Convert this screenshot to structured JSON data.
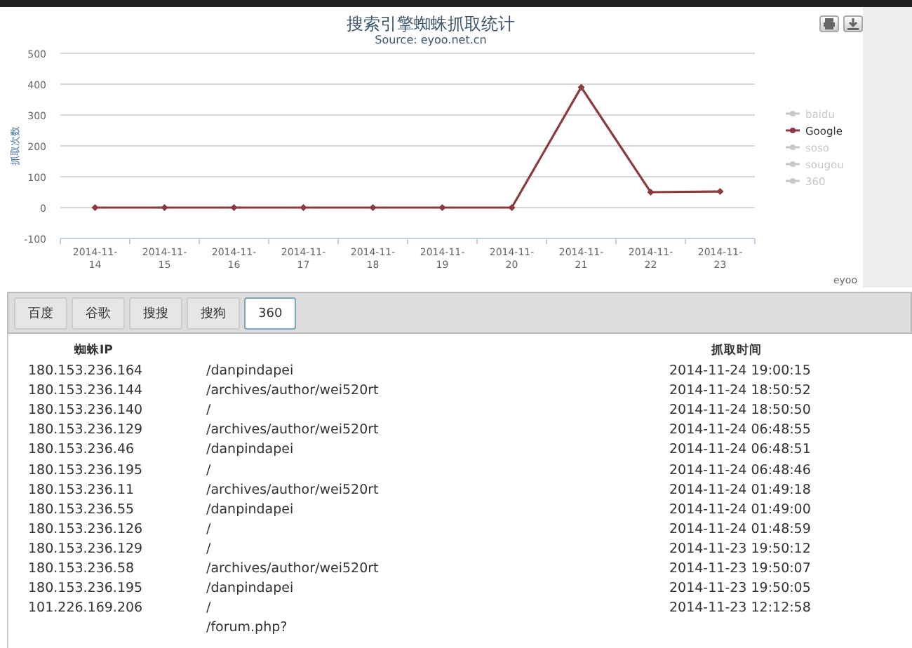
{
  "chart": {
    "title": "搜索引擎蜘蛛抓取统计",
    "subtitle": "Source: eyoo.net.cn",
    "credits": "eyoo",
    "chart_data": {
      "type": "line",
      "grid": true,
      "ylabel": "抓取次数",
      "categories": [
        "2014-11-14",
        "2014-11-15",
        "2014-11-16",
        "2014-11-17",
        "2014-11-18",
        "2014-11-19",
        "2014-11-20",
        "2014-11-21",
        "2014-11-22",
        "2014-11-23"
      ],
      "ylim": [
        -100,
        500
      ],
      "yticks": [
        -100,
        0,
        100,
        200,
        300,
        400,
        500
      ],
      "series": [
        {
          "name": "Google",
          "color": "#8b3a3e",
          "marker": "diamond",
          "values": [
            0,
            0,
            0,
            0,
            0,
            0,
            0,
            390,
            50,
            52
          ]
        }
      ]
    },
    "legend": [
      {
        "name": "baidu",
        "selected": false
      },
      {
        "kind": "series",
        "selected": true
      },
      {
        "name": "soso",
        "selected": false
      },
      {
        "name": "sougou",
        "selected": false
      },
      {
        "name": "360",
        "selected": false
      }
    ]
  },
  "tabs": [
    {
      "label": "百度",
      "selected": false
    },
    {
      "label": "谷歌",
      "selected": false
    },
    {
      "label": "搜搜",
      "selected": false
    },
    {
      "label": "搜狗",
      "selected": false
    },
    {
      "label": "360",
      "selected": true
    }
  ],
  "table": {
    "columns": [
      "蜘蛛IP",
      "抓取时间"
    ],
    "rows": [
      {
        "ip": "180.153.236.164",
        "page": "/danpindapei",
        "time": "2014-11-24 19:00:15"
      },
      {
        "ip": "180.153.236.144",
        "page": "/archives/author/wei520rt",
        "time": "2014-11-24 18:50:52"
      },
      {
        "ip": "180.153.236.140",
        "page": "/",
        "time": "2014-11-24 18:50:50"
      },
      {
        "ip": "180.153.236.129",
        "page": "/archives/author/wei520rt",
        "time": "2014-11-24 06:48:55"
      },
      {
        "ip": "180.153.236.46",
        "page": "/danpindapei",
        "time": "2014-11-24 06:48:51"
      },
      {
        "ip": "180.153.236.195",
        "page": "/",
        "time": "2014-11-24 06:48:46"
      },
      {
        "ip": "180.153.236.11",
        "page": "/archives/author/wei520rt",
        "time": "2014-11-24 01:49:18"
      },
      {
        "ip": "180.153.236.55",
        "page": "/danpindapei",
        "time": "2014-11-24 01:49:00"
      },
      {
        "ip": "180.153.236.126",
        "page": "/",
        "time": "2014-11-24 01:48:59"
      },
      {
        "ip": "180.153.236.129",
        "page": "/",
        "time": "2014-11-23 19:50:12"
      },
      {
        "ip": "180.153.236.58",
        "page": "/archives/author/wei520rt",
        "time": "2014-11-23 19:50:07"
      },
      {
        "ip": "180.153.236.195",
        "page": "/danpindapei",
        "time": "2014-11-23 19:50:05"
      },
      {
        "ip": "101.226.169.206",
        "page": "/",
        "time": "2014-11-23 12:12:58"
      },
      {
        "page": "/forum.php?"
      }
    ]
  }
}
